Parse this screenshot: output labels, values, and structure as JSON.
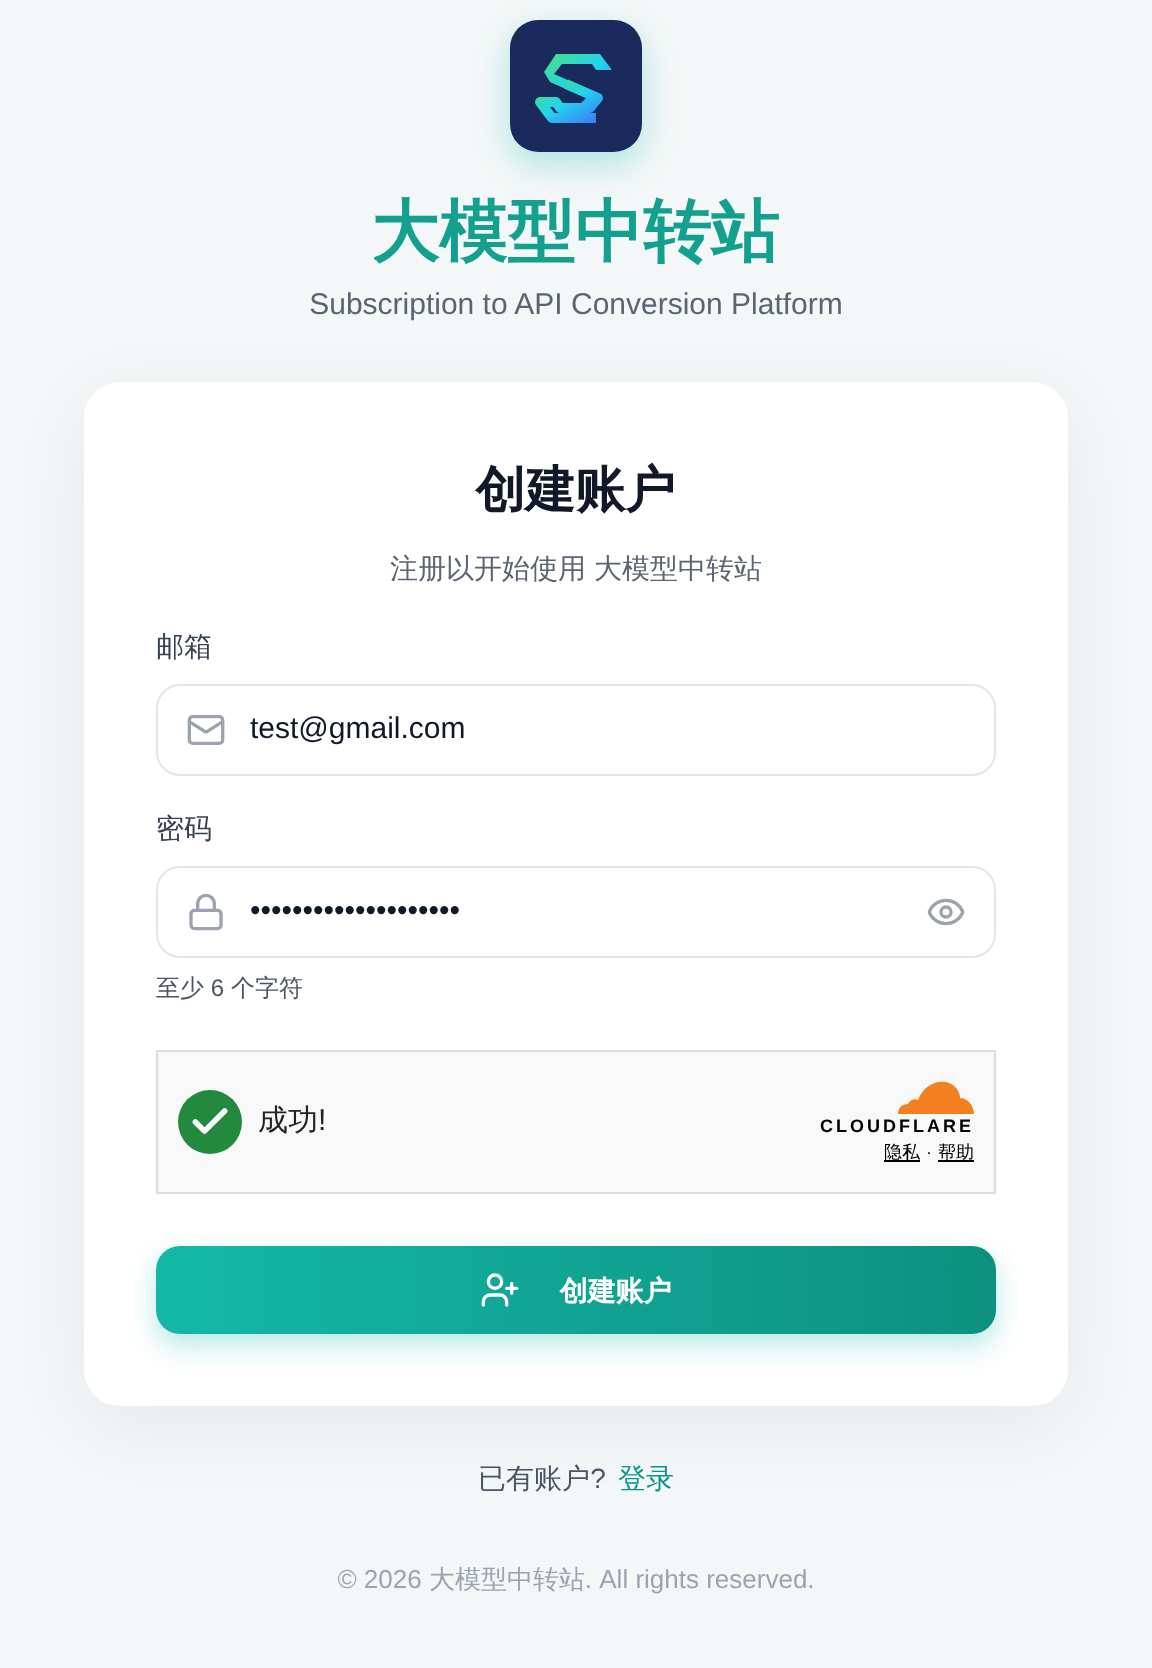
{
  "brand": {
    "title": "大模型中转站",
    "subtitle": "Subscription to API Conversion Platform"
  },
  "card": {
    "title": "创建账户",
    "subtitle": "注册以开始使用 大模型中转站",
    "fields": [
      {
        "kind": "email",
        "label": "邮箱",
        "value": "test@gmail.com"
      },
      {
        "kind": "password",
        "label": "密码",
        "value": "••••••••••••••••••••",
        "hint": "至少 6 个字符"
      }
    ],
    "captcha": {
      "status": "成功!",
      "success": true,
      "provider": "CLOUDFLARE",
      "links": [
        "隐私",
        "帮助"
      ],
      "separator": "·"
    },
    "submit": "创建账户"
  },
  "login_prompt": {
    "text": "已有账户?",
    "link": "登录"
  },
  "footer": "© 2026 大模型中转站. All rights reserved."
}
